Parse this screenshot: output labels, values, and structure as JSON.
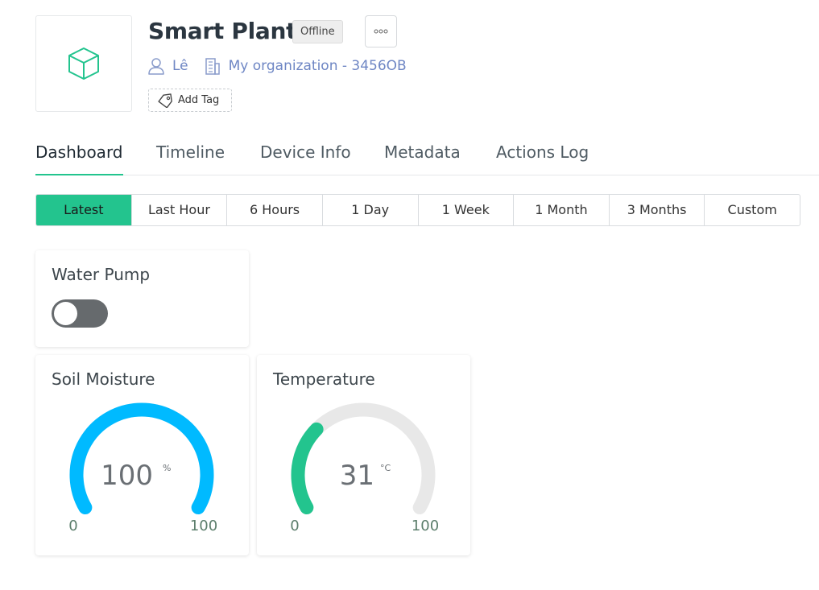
{
  "device": {
    "name": "Smart Plant",
    "status": "Offline",
    "owner": "Lê",
    "organization": "My organization - 3456OB",
    "add_tag_label": "Add Tag",
    "image_icon": "cube-icon"
  },
  "tabs": [
    {
      "label": "Dashboard",
      "active": true
    },
    {
      "label": "Timeline",
      "active": false
    },
    {
      "label": "Device Info",
      "active": false
    },
    {
      "label": "Metadata",
      "active": false
    },
    {
      "label": "Actions Log",
      "active": false
    }
  ],
  "time_ranges": [
    {
      "label": "Latest",
      "active": true
    },
    {
      "label": "Last Hour",
      "active": false
    },
    {
      "label": "6 Hours",
      "active": false
    },
    {
      "label": "1 Day",
      "active": false
    },
    {
      "label": "1 Week",
      "active": false
    },
    {
      "label": "1 Month",
      "active": false
    },
    {
      "label": "3 Months",
      "active": false
    },
    {
      "label": "Custom",
      "active": false
    }
  ],
  "widgets": {
    "water_pump": {
      "title": "Water Pump",
      "state": "off"
    },
    "soil_moisture": {
      "title": "Soil Moisture",
      "value": "100",
      "unit": "%",
      "min": "0",
      "max": "100",
      "fill": 1.0,
      "color": "#00baff"
    },
    "temperature": {
      "title": "Temperature",
      "value": "31",
      "unit": "°C",
      "min": "0",
      "max": "100",
      "fill": 0.31,
      "color": "#23c48e"
    }
  },
  "colors": {
    "accent": "#23c48e",
    "link": "#6e86c4",
    "gauge_track": "#e8e8e8"
  }
}
